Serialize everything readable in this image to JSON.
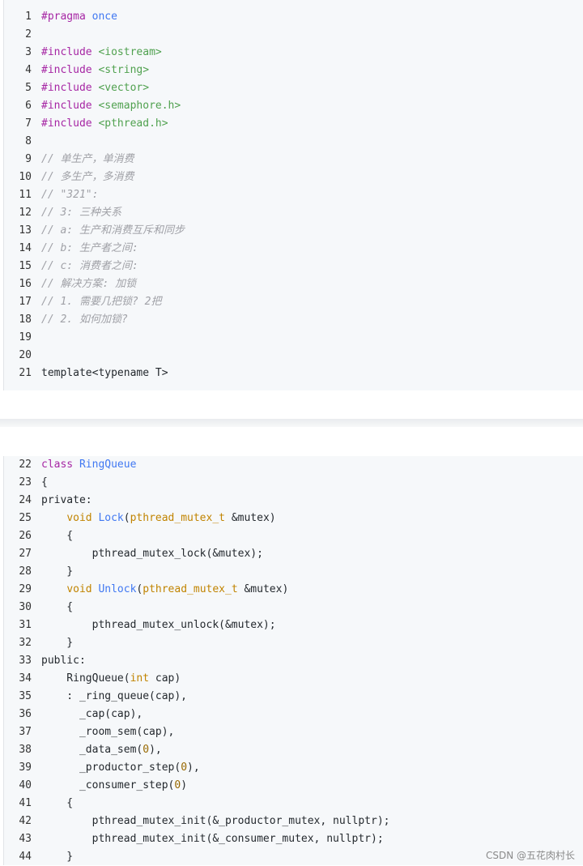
{
  "block1": [
    {
      "n": "1",
      "t": [
        [
          "kw",
          "#pragma "
        ],
        [
          "fn",
          "once"
        ]
      ]
    },
    {
      "n": "2",
      "t": []
    },
    {
      "n": "3",
      "t": [
        [
          "kw",
          "#include "
        ],
        [
          "str",
          "<iostream>"
        ]
      ]
    },
    {
      "n": "4",
      "t": [
        [
          "kw",
          "#include "
        ],
        [
          "str",
          "<string>"
        ]
      ]
    },
    {
      "n": "5",
      "t": [
        [
          "kw",
          "#include "
        ],
        [
          "str",
          "<vector>"
        ]
      ]
    },
    {
      "n": "6",
      "t": [
        [
          "kw",
          "#include "
        ],
        [
          "str",
          "<semaphore.h>"
        ]
      ]
    },
    {
      "n": "7",
      "t": [
        [
          "kw",
          "#include "
        ],
        [
          "str",
          "<pthread.h>"
        ]
      ]
    },
    {
      "n": "8",
      "t": []
    },
    {
      "n": "9",
      "t": [
        [
          "cm",
          "// 单生产，单消费"
        ]
      ]
    },
    {
      "n": "10",
      "t": [
        [
          "cm",
          "// 多生产，多消费"
        ]
      ]
    },
    {
      "n": "11",
      "t": [
        [
          "cm",
          "// \"321\":"
        ]
      ]
    },
    {
      "n": "12",
      "t": [
        [
          "cm",
          "// 3: 三种关系"
        ]
      ]
    },
    {
      "n": "13",
      "t": [
        [
          "cm",
          "// a: 生产和消费互斥和同步"
        ]
      ]
    },
    {
      "n": "14",
      "t": [
        [
          "cm",
          "// b: 生产者之间:"
        ]
      ]
    },
    {
      "n": "15",
      "t": [
        [
          "cm",
          "// c: 消费者之间:"
        ]
      ]
    },
    {
      "n": "16",
      "t": [
        [
          "cm",
          "// 解决方案: 加锁"
        ]
      ]
    },
    {
      "n": "17",
      "t": [
        [
          "cm",
          "// 1. 需要几把锁? 2把"
        ]
      ]
    },
    {
      "n": "18",
      "t": [
        [
          "cm",
          "// 2. 如何加锁?"
        ]
      ]
    },
    {
      "n": "19",
      "t": []
    },
    {
      "n": "20",
      "t": []
    },
    {
      "n": "21",
      "t": [
        [
          "",
          "template<typename T>"
        ]
      ]
    }
  ],
  "block2": [
    {
      "n": "22",
      "t": [
        [
          "kw",
          "class "
        ],
        [
          "fn",
          "RingQueue"
        ]
      ]
    },
    {
      "n": "23",
      "t": [
        [
          "",
          "{"
        ]
      ]
    },
    {
      "n": "24",
      "t": [
        [
          "",
          "private:"
        ]
      ]
    },
    {
      "n": "25",
      "t": [
        [
          "",
          "    "
        ],
        [
          "ty",
          "void "
        ],
        [
          "fn",
          "Lock"
        ],
        [
          "",
          "("
        ],
        [
          "ty",
          "pthread_mutex_t "
        ],
        [
          "",
          "&mutex)"
        ]
      ]
    },
    {
      "n": "26",
      "t": [
        [
          "",
          "    {"
        ]
      ]
    },
    {
      "n": "27",
      "t": [
        [
          "",
          "        pthread_mutex_lock(&mutex);"
        ]
      ]
    },
    {
      "n": "28",
      "t": [
        [
          "",
          "    }"
        ]
      ]
    },
    {
      "n": "29",
      "t": [
        [
          "",
          "    "
        ],
        [
          "ty",
          "void "
        ],
        [
          "fn",
          "Unlock"
        ],
        [
          "",
          "("
        ],
        [
          "ty",
          "pthread_mutex_t "
        ],
        [
          "",
          "&mutex)"
        ]
      ]
    },
    {
      "n": "30",
      "t": [
        [
          "",
          "    {"
        ]
      ]
    },
    {
      "n": "31",
      "t": [
        [
          "",
          "        pthread_mutex_unlock(&mutex);"
        ]
      ]
    },
    {
      "n": "32",
      "t": [
        [
          "",
          "    }"
        ]
      ]
    },
    {
      "n": "33",
      "t": [
        [
          "",
          "public:"
        ]
      ]
    },
    {
      "n": "34",
      "t": [
        [
          "",
          "    RingQueue("
        ],
        [
          "ty",
          "int "
        ],
        [
          "",
          "cap)"
        ]
      ]
    },
    {
      "n": "35",
      "t": [
        [
          "",
          "    : _ring_queue(cap),"
        ]
      ]
    },
    {
      "n": "36",
      "t": [
        [
          "",
          "      _cap(cap),"
        ]
      ]
    },
    {
      "n": "37",
      "t": [
        [
          "",
          "      _room_sem(cap),"
        ]
      ]
    },
    {
      "n": "38",
      "t": [
        [
          "",
          "      _data_sem("
        ],
        [
          "num",
          "0"
        ],
        [
          "",
          "),"
        ]
      ]
    },
    {
      "n": "39",
      "t": [
        [
          "",
          "      _productor_step("
        ],
        [
          "num",
          "0"
        ],
        [
          "",
          "),"
        ]
      ]
    },
    {
      "n": "40",
      "t": [
        [
          "",
          "      _consumer_step("
        ],
        [
          "num",
          "0"
        ],
        [
          "",
          ")"
        ]
      ]
    },
    {
      "n": "41",
      "t": [
        [
          "",
          "    {"
        ]
      ]
    },
    {
      "n": "42",
      "t": [
        [
          "",
          "        pthread_mutex_init(&_productor_mutex, nullptr);"
        ]
      ]
    },
    {
      "n": "43",
      "t": [
        [
          "",
          "        pthread_mutex_init(&_consumer_mutex, nullptr);"
        ]
      ]
    },
    {
      "n": "44",
      "t": [
        [
          "",
          "    }"
        ]
      ]
    }
  ],
  "watermark": "CSDN @五花肉村长"
}
